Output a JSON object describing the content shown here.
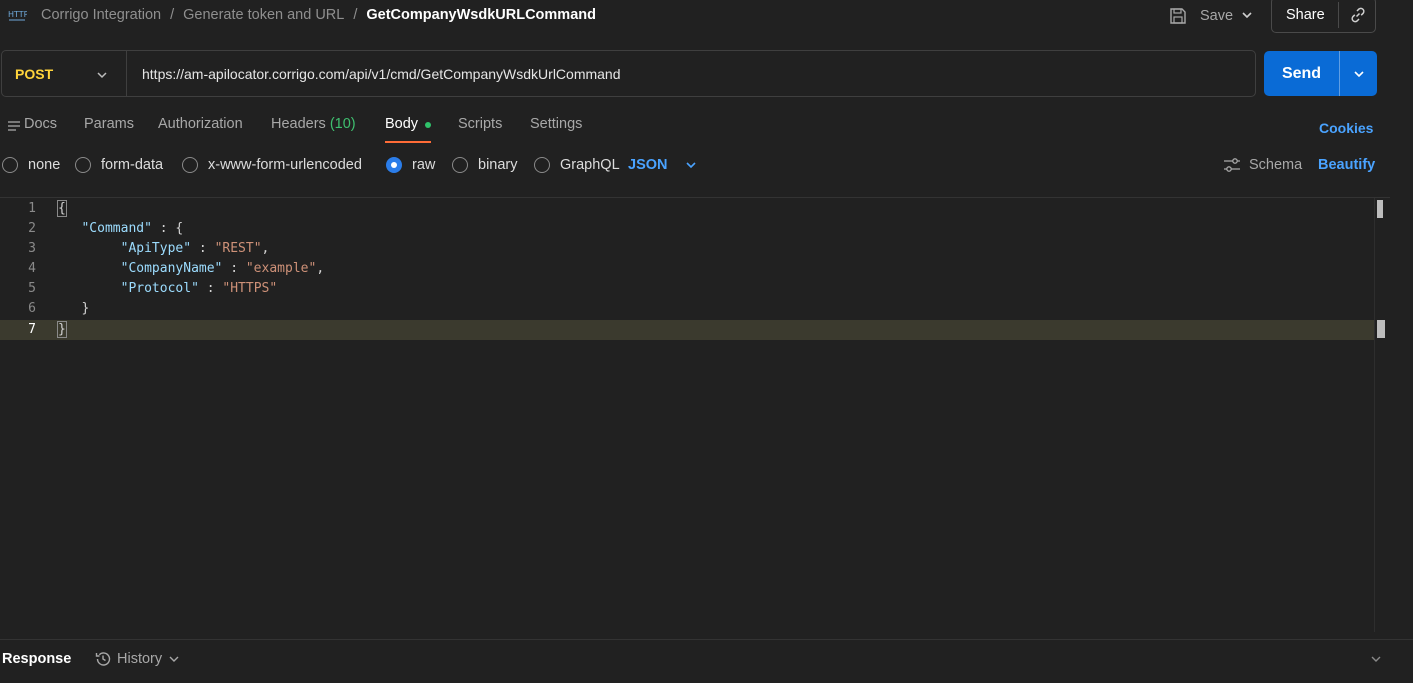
{
  "header": {
    "breadcrumbs": [
      "Corrigo Integration",
      "Generate token and URL"
    ],
    "current": "GetCompanyWsdkURLCommand",
    "separator": "/",
    "save_label": "Save",
    "share_label": "Share"
  },
  "request": {
    "method": "POST",
    "url": "https://am-apilocator.corrigo.com/api/v1/cmd/GetCompanyWsdkUrlCommand",
    "send_label": "Send"
  },
  "tabs": {
    "docs": "Docs",
    "params": "Params",
    "authorization": "Authorization",
    "headers": "Headers",
    "headers_count": "(10)",
    "body": "Body",
    "scripts": "Scripts",
    "settings": "Settings",
    "cookies": "Cookies"
  },
  "body_options": {
    "items": [
      "none",
      "form-data",
      "x-www-form-urlencoded",
      "raw",
      "binary",
      "GraphQL"
    ],
    "selected": "raw",
    "format": "JSON",
    "schema": "Schema",
    "beautify": "Beautify"
  },
  "editor": {
    "line_numbers": [
      "1",
      "2",
      "3",
      "4",
      "5",
      "6",
      "7"
    ],
    "current_line": 7,
    "open_brace": "{",
    "close_brace": "}",
    "command_key": "\"Command\"",
    "api_type_key": "\"ApiType\"",
    "api_type_value": "\"REST\"",
    "company_name_key": "\"CompanyName\"",
    "company_name_value": "\"example\"",
    "protocol_key": "\"Protocol\"",
    "protocol_value": "\"HTTPS\""
  },
  "response": {
    "label": "Response",
    "history": "History"
  },
  "colors": {
    "accent_blue": "#0a6bd6",
    "method_yellow": "#ffd43b",
    "tab_underline": "#ff6c37",
    "link_blue": "#4aa3ff"
  }
}
